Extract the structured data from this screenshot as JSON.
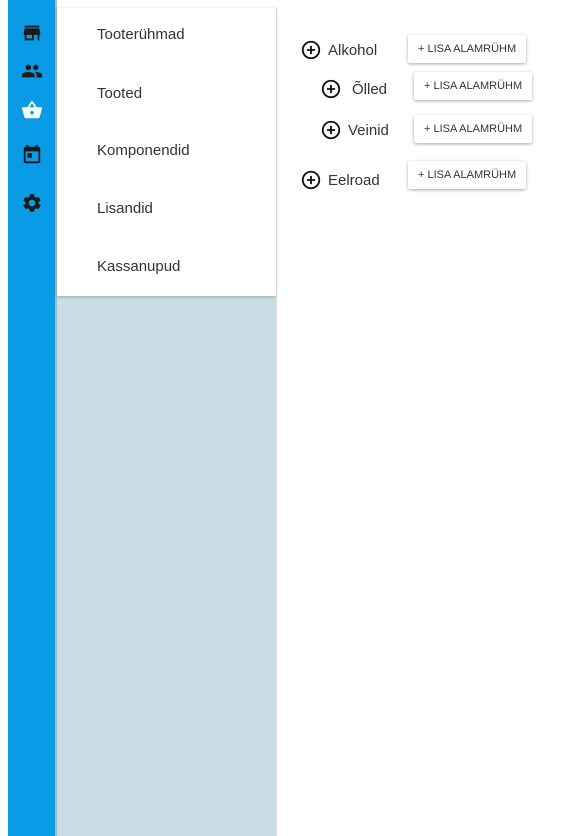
{
  "rail": {
    "background": "#0a9be6",
    "icons": [
      "store-icon",
      "people-icon",
      "basket-icon",
      "calendar-icon",
      "settings-icon"
    ]
  },
  "submenu": {
    "items": [
      {
        "label": "Tooterühmad"
      },
      {
        "label": "Tooted"
      },
      {
        "label": "Komponendid"
      },
      {
        "label": "Lisandid"
      },
      {
        "label": "Kassanupud"
      }
    ]
  },
  "groups": [
    {
      "name": "Alkohol",
      "button": "+ LISA ALAMRÜHM"
    },
    {
      "name": "Õlled",
      "button": "+ LISA ALAMRÜHM"
    },
    {
      "name": "Veinid",
      "button": "+ LISA ALAMRÜHM"
    },
    {
      "name": "Eelroad",
      "button": "+ LISA ALAMRÜHM"
    }
  ]
}
